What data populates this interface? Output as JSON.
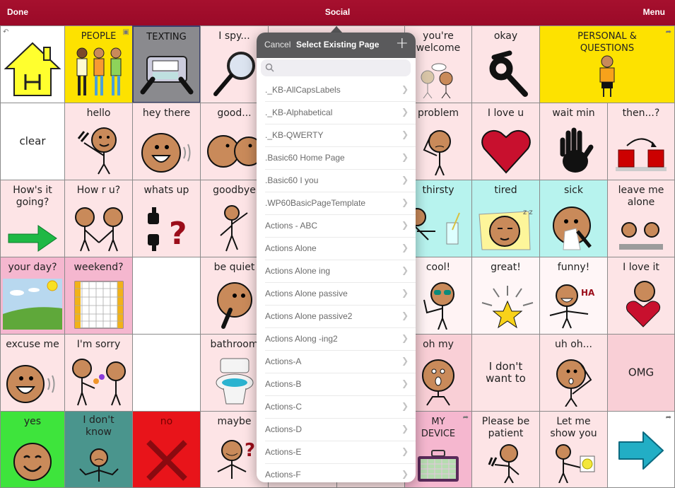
{
  "topbar": {
    "done_label": "Done",
    "title": "Social",
    "menu_label": "Menu"
  },
  "colors": {
    "topbar": "#a30f2d",
    "popover_header": "#5a5a5c"
  },
  "grid": {
    "cells": [
      {
        "label": "",
        "icon": "home-icon",
        "note": "home"
      },
      {
        "label": "PEOPLE",
        "icon": "people-icon"
      },
      {
        "label": "TEXTING",
        "icon": "phone-icon"
      },
      {
        "label": "I spy...",
        "icon": "magnifier-icon"
      },
      {
        "label": "you're welcome",
        "icon": "talking-people-icon"
      },
      {
        "label": "okay",
        "icon": "ok-hand-icon"
      },
      {
        "label": "PERSONAL & QUESTIONS",
        "icon": "person-icon"
      },
      {
        "label": "clear"
      },
      {
        "label": "hello",
        "icon": "waving-person-icon"
      },
      {
        "label": "hey there",
        "icon": "smiling-face-icon"
      },
      {
        "label": "good...",
        "icon": "kissing-faces-icon"
      },
      {
        "label": "problem",
        "icon": "worried-person-icon"
      },
      {
        "label": "I love u",
        "icon": "heart-icon"
      },
      {
        "label": "wait min",
        "icon": "hand-stop-icon"
      },
      {
        "label": "then...?",
        "icon": "next-arrow-icon"
      },
      {
        "label": "How's it going?",
        "icon": "green-arrow-icon"
      },
      {
        "label": "How r u?",
        "icon": "handshake-icon"
      },
      {
        "label": "whats up",
        "icon": "thumbs-question-icon"
      },
      {
        "label": "goodbye",
        "icon": "waving-goodbye-icon"
      },
      {
        "label": "thirsty",
        "icon": "glass-icon"
      },
      {
        "label": "tired",
        "icon": "sleeping-face-icon"
      },
      {
        "label": "sick",
        "icon": "tissue-face-icon"
      },
      {
        "label": "leave me alone",
        "icon": "two-people-icon"
      },
      {
        "label": "your day?",
        "icon": "landscape-icon"
      },
      {
        "label": "weekend?",
        "icon": "calendar-icon"
      },
      {
        "label": ""
      },
      {
        "label": "be quiet",
        "icon": "shush-face-icon"
      },
      {
        "label": "cool!",
        "icon": "sunglasses-person-icon"
      },
      {
        "label": "great!",
        "icon": "star-icon"
      },
      {
        "label": "funny!",
        "icon": "laughing-person-icon"
      },
      {
        "label": "I love it",
        "icon": "hugging-heart-icon"
      },
      {
        "label": "excuse me",
        "icon": "smiling-face-icon"
      },
      {
        "label": "I'm sorry",
        "icon": "apology-people-icon"
      },
      {
        "label": ""
      },
      {
        "label": "bathroom",
        "icon": "toilet-icon"
      },
      {
        "label": "oh my",
        "icon": "surprised-face-icon"
      },
      {
        "label": "I don't want to"
      },
      {
        "label": "uh oh...",
        "icon": "uh-oh-person-icon"
      },
      {
        "label": "OMG"
      },
      {
        "label": "yes",
        "icon": "happy-face-icon"
      },
      {
        "label": "I don't know",
        "icon": "shrug-person-icon"
      },
      {
        "label": "no",
        "icon": "x-icon"
      },
      {
        "label": "maybe",
        "icon": "maybe-person-icon"
      },
      {
        "label": "MY DEVICE",
        "icon": "device-icon"
      },
      {
        "label": "Please be patient",
        "icon": "patient-person-icon"
      },
      {
        "label": "Let me show you",
        "icon": "showing-person-icon"
      },
      {
        "label": "",
        "icon": "blue-arrow-icon"
      }
    ]
  },
  "popover": {
    "cancel_label": "Cancel",
    "title": "Select Existing Page",
    "add_label": "+",
    "search": {
      "value": "",
      "placeholder": ""
    },
    "items": [
      "._KB-AllCapsLabels",
      "._KB-Alphabetical",
      "._KB-QWERTY",
      ".Basic60 Home Page",
      ".Basic60 I you",
      ".WP60BasicPageTemplate",
      "Actions - ABC",
      "Actions Alone",
      "Actions Alone ing",
      "Actions Alone passive",
      "Actions Alone passive2",
      "Actions Along -ing2",
      "Actions-A",
      "Actions-B",
      "Actions-C",
      "Actions-D",
      "Actions-E",
      "Actions-F"
    ]
  }
}
